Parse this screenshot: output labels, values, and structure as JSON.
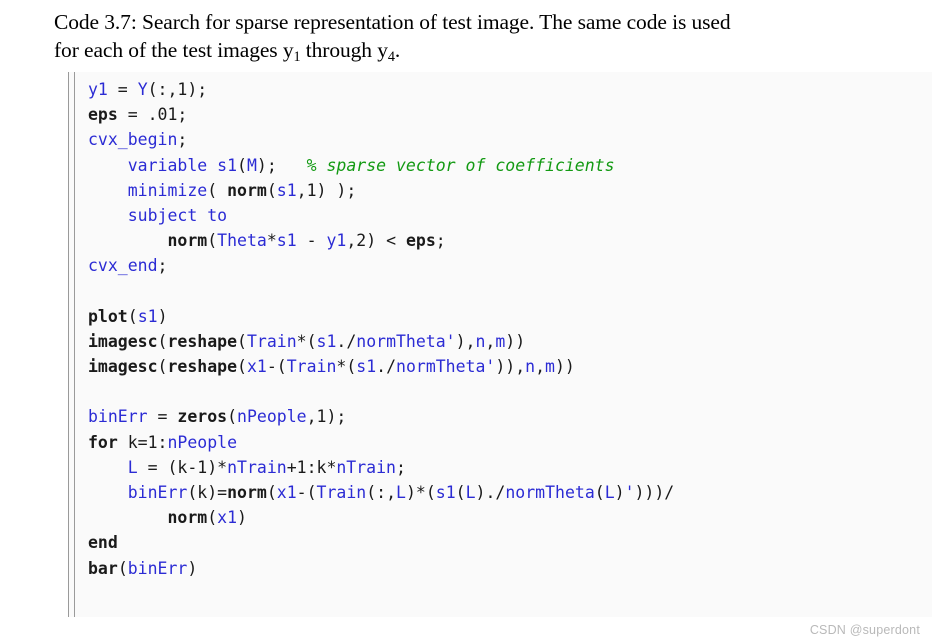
{
  "caption": {
    "line1_pre": "Code 3.7: Search for sparse representation of test image. The same code is used",
    "line2_pre": "for each of the test images y",
    "line2_sub1": "1",
    "line2_mid": " through y",
    "line2_sub2": "4",
    "line2_post": "."
  },
  "colors": {
    "identifier_blue": "#2b2bd4",
    "function_black": "#1a1a1a",
    "comment_green": "#139a13",
    "code_background": "#fafafa",
    "rule_gray": "#9a9a9a",
    "watermark_gray": "#b9b9b9",
    "page_background": "#ffffff"
  },
  "code": {
    "language": "MATLAB",
    "lines": [
      [
        {
          "t": "ident",
          "s": "y1"
        },
        {
          "t": "plain",
          "s": " = "
        },
        {
          "t": "ident",
          "s": "Y"
        },
        {
          "t": "plain",
          "s": "(:,1);"
        }
      ],
      [
        {
          "t": "fn",
          "s": "eps"
        },
        {
          "t": "plain",
          "s": " = .01;"
        }
      ],
      [
        {
          "t": "kw",
          "s": "cvx_begin"
        },
        {
          "t": "plain",
          "s": ";"
        }
      ],
      [
        {
          "t": "plain",
          "s": "    "
        },
        {
          "t": "kw",
          "s": "variable"
        },
        {
          "t": "plain",
          "s": " "
        },
        {
          "t": "ident",
          "s": "s1"
        },
        {
          "t": "plain",
          "s": "("
        },
        {
          "t": "ident",
          "s": "M"
        },
        {
          "t": "plain",
          "s": ");   "
        },
        {
          "t": "comment",
          "s": "% sparse vector of coefficients"
        }
      ],
      [
        {
          "t": "plain",
          "s": "    "
        },
        {
          "t": "kw",
          "s": "minimize"
        },
        {
          "t": "plain",
          "s": "( "
        },
        {
          "t": "fn",
          "s": "norm"
        },
        {
          "t": "plain",
          "s": "("
        },
        {
          "t": "ident",
          "s": "s1"
        },
        {
          "t": "plain",
          "s": ",1) );"
        }
      ],
      [
        {
          "t": "plain",
          "s": "    "
        },
        {
          "t": "kw",
          "s": "subject to"
        }
      ],
      [
        {
          "t": "plain",
          "s": "        "
        },
        {
          "t": "fn",
          "s": "norm"
        },
        {
          "t": "plain",
          "s": "("
        },
        {
          "t": "ident",
          "s": "Theta"
        },
        {
          "t": "plain",
          "s": "*"
        },
        {
          "t": "ident",
          "s": "s1"
        },
        {
          "t": "plain",
          "s": " - "
        },
        {
          "t": "ident",
          "s": "y1"
        },
        {
          "t": "plain",
          "s": ",2) < "
        },
        {
          "t": "fn",
          "s": "eps"
        },
        {
          "t": "plain",
          "s": ";"
        }
      ],
      [
        {
          "t": "kw",
          "s": "cvx_end"
        },
        {
          "t": "plain",
          "s": ";"
        }
      ],
      [],
      [
        {
          "t": "fn",
          "s": "plot"
        },
        {
          "t": "plain",
          "s": "("
        },
        {
          "t": "ident",
          "s": "s1"
        },
        {
          "t": "plain",
          "s": ")"
        }
      ],
      [
        {
          "t": "fn",
          "s": "imagesc"
        },
        {
          "t": "plain",
          "s": "("
        },
        {
          "t": "fn",
          "s": "reshape"
        },
        {
          "t": "plain",
          "s": "("
        },
        {
          "t": "ident",
          "s": "Train"
        },
        {
          "t": "plain",
          "s": "*("
        },
        {
          "t": "ident",
          "s": "s1"
        },
        {
          "t": "plain",
          "s": "./"
        },
        {
          "t": "ident",
          "s": "normTheta"
        },
        {
          "t": "str",
          "s": "'"
        },
        {
          "t": "plain",
          "s": "),"
        },
        {
          "t": "ident",
          "s": "n"
        },
        {
          "t": "plain",
          "s": ","
        },
        {
          "t": "ident",
          "s": "m"
        },
        {
          "t": "plain",
          "s": "))"
        }
      ],
      [
        {
          "t": "fn",
          "s": "imagesc"
        },
        {
          "t": "plain",
          "s": "("
        },
        {
          "t": "fn",
          "s": "reshape"
        },
        {
          "t": "plain",
          "s": "("
        },
        {
          "t": "ident",
          "s": "x1"
        },
        {
          "t": "plain",
          "s": "-("
        },
        {
          "t": "ident",
          "s": "Train"
        },
        {
          "t": "plain",
          "s": "*("
        },
        {
          "t": "ident",
          "s": "s1"
        },
        {
          "t": "plain",
          "s": "./"
        },
        {
          "t": "ident",
          "s": "normTheta"
        },
        {
          "t": "str",
          "s": "'"
        },
        {
          "t": "plain",
          "s": ")),"
        },
        {
          "t": "ident",
          "s": "n"
        },
        {
          "t": "plain",
          "s": ","
        },
        {
          "t": "ident",
          "s": "m"
        },
        {
          "t": "plain",
          "s": "))"
        }
      ],
      [],
      [
        {
          "t": "ident",
          "s": "binErr"
        },
        {
          "t": "plain",
          "s": " = "
        },
        {
          "t": "fn",
          "s": "zeros"
        },
        {
          "t": "plain",
          "s": "("
        },
        {
          "t": "ident",
          "s": "nPeople"
        },
        {
          "t": "plain",
          "s": ",1);"
        }
      ],
      [
        {
          "t": "ctrl",
          "s": "for"
        },
        {
          "t": "plain",
          "s": " k=1:"
        },
        {
          "t": "ident",
          "s": "nPeople"
        }
      ],
      [
        {
          "t": "plain",
          "s": "    "
        },
        {
          "t": "ident",
          "s": "L"
        },
        {
          "t": "plain",
          "s": " = (k-1)*"
        },
        {
          "t": "ident",
          "s": "nTrain"
        },
        {
          "t": "plain",
          "s": "+1:k*"
        },
        {
          "t": "ident",
          "s": "nTrain"
        },
        {
          "t": "plain",
          "s": ";"
        }
      ],
      [
        {
          "t": "plain",
          "s": "    "
        },
        {
          "t": "ident",
          "s": "binErr"
        },
        {
          "t": "plain",
          "s": "(k)="
        },
        {
          "t": "fn",
          "s": "norm"
        },
        {
          "t": "plain",
          "s": "("
        },
        {
          "t": "ident",
          "s": "x1"
        },
        {
          "t": "plain",
          "s": "-("
        },
        {
          "t": "ident",
          "s": "Train"
        },
        {
          "t": "plain",
          "s": "(:,"
        },
        {
          "t": "ident",
          "s": "L"
        },
        {
          "t": "plain",
          "s": ")*("
        },
        {
          "t": "ident",
          "s": "s1"
        },
        {
          "t": "plain",
          "s": "("
        },
        {
          "t": "ident",
          "s": "L"
        },
        {
          "t": "plain",
          "s": ")./"
        },
        {
          "t": "ident",
          "s": "normTheta"
        },
        {
          "t": "plain",
          "s": "("
        },
        {
          "t": "ident",
          "s": "L"
        },
        {
          "t": "plain",
          "s": ")"
        },
        {
          "t": "str",
          "s": "'"
        },
        {
          "t": "plain",
          "s": ")))/"
        }
      ],
      [
        {
          "t": "plain",
          "s": "        "
        },
        {
          "t": "fn",
          "s": "norm"
        },
        {
          "t": "plain",
          "s": "("
        },
        {
          "t": "ident",
          "s": "x1"
        },
        {
          "t": "plain",
          "s": ")"
        }
      ],
      [
        {
          "t": "ctrl",
          "s": "end"
        }
      ],
      [
        {
          "t": "fn",
          "s": "bar"
        },
        {
          "t": "plain",
          "s": "("
        },
        {
          "t": "ident",
          "s": "binErr"
        },
        {
          "t": "plain",
          "s": ")"
        }
      ]
    ]
  },
  "watermark": {
    "text": "CSDN @superdont"
  }
}
